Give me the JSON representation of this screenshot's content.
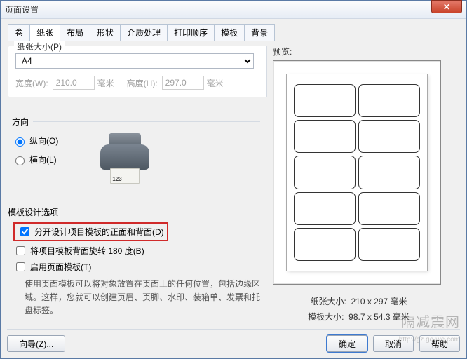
{
  "window": {
    "title": "页面设置"
  },
  "tabs": [
    "卷",
    "纸张",
    "布局",
    "形状",
    "介质处理",
    "打印顺序",
    "模板",
    "背景"
  ],
  "activeTab": 1,
  "paperSize": {
    "legend": "纸张大小(P)",
    "selected": "A4",
    "widthLabel": "宽度(W):",
    "widthValue": "210.0",
    "heightLabel": "高度(H):",
    "heightValue": "297.0",
    "unit": "毫米"
  },
  "orientation": {
    "legend": "方向",
    "portrait": "纵向(O)",
    "landscape": "横向(L)",
    "printerBadge": "123"
  },
  "templateOptions": {
    "legend": "模板设计选项",
    "separateFrontBack": "分开设计项目模板的正面和背面(D)",
    "rotate180": "将项目模板背面旋转 180 度(B)",
    "enablePageTemplate": "启用页面模板(T)",
    "helpText": "使用页面模板可以将对象放置在页面上的任何位置，包括边缘区域。这样，您就可以创建页眉、页脚、水印、装箱单、发票和托盘标签。"
  },
  "preview": {
    "label": "预览:",
    "paperSizeLabel": "纸张大小:",
    "paperSizeValue": "210 x 297 毫米",
    "templateSizeLabel": "模板大小:",
    "templateSizeValue": "98.7 x 54.3 毫米"
  },
  "buttons": {
    "wizard": "向导(Z)...",
    "ok": "确定",
    "cancel": "取消",
    "help": "帮助"
  },
  "watermark": {
    "text": "隔减震网",
    "url": "http://gz.go-we.com"
  }
}
